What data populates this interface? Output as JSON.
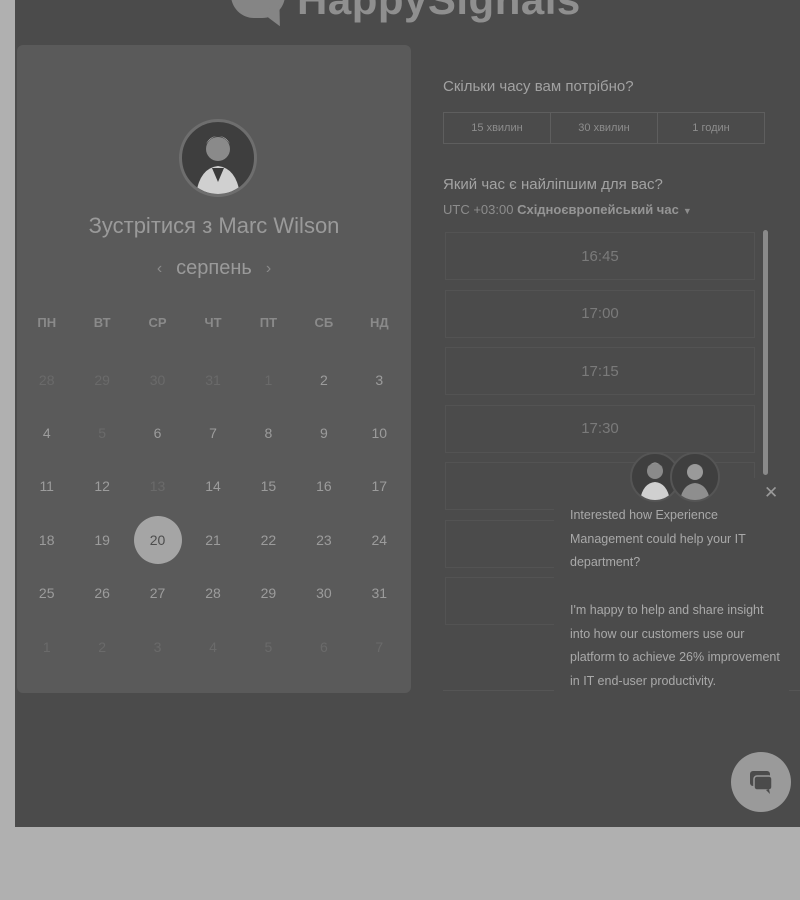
{
  "header": {
    "logo_text": "HappySignals"
  },
  "booking": {
    "meet_title": "Зустрітися з Marc Wilson",
    "month": "серпень",
    "weekdays": [
      "ПН",
      "ВТ",
      "СР",
      "ЧТ",
      "ПТ",
      "СБ",
      "НД"
    ],
    "days": [
      {
        "n": "28",
        "muted": true
      },
      {
        "n": "29",
        "muted": true
      },
      {
        "n": "30",
        "muted": true
      },
      {
        "n": "31",
        "muted": true
      },
      {
        "n": "1",
        "muted": true
      },
      {
        "n": "2"
      },
      {
        "n": "3"
      },
      {
        "n": "4"
      },
      {
        "n": "5",
        "muted": true
      },
      {
        "n": "6"
      },
      {
        "n": "7"
      },
      {
        "n": "8"
      },
      {
        "n": "9"
      },
      {
        "n": "10"
      },
      {
        "n": "11"
      },
      {
        "n": "12"
      },
      {
        "n": "13",
        "muted": true
      },
      {
        "n": "14"
      },
      {
        "n": "15"
      },
      {
        "n": "16"
      },
      {
        "n": "17"
      },
      {
        "n": "18"
      },
      {
        "n": "19"
      },
      {
        "n": "20",
        "selected": true
      },
      {
        "n": "21"
      },
      {
        "n": "22"
      },
      {
        "n": "23"
      },
      {
        "n": "24"
      },
      {
        "n": "25"
      },
      {
        "n": "26"
      },
      {
        "n": "27"
      },
      {
        "n": "28"
      },
      {
        "n": "29"
      },
      {
        "n": "30"
      },
      {
        "n": "31"
      },
      {
        "n": "1",
        "muted": true
      },
      {
        "n": "2",
        "muted": true
      },
      {
        "n": "3",
        "muted": true
      },
      {
        "n": "4",
        "muted": true
      },
      {
        "n": "5",
        "muted": true
      },
      {
        "n": "6",
        "muted": true
      },
      {
        "n": "7",
        "muted": true
      }
    ]
  },
  "duration": {
    "question": "Скільки часу вам потрібно?",
    "options": [
      "15 хвилин",
      "30 хвилин",
      "1 годин"
    ]
  },
  "time": {
    "question": "Який час є найліпшим для вас?",
    "tz_offset": "UTC +03:00",
    "tz_name": "Східноєвропейський час",
    "slots": [
      "16:45",
      "17:00",
      "17:15",
      "17:30",
      "",
      "",
      ""
    ]
  },
  "chat": {
    "message": "Interested how Experience Management could help your IT department?\n\nI'm happy to help and share insight into how our customers use our platform to achieve 26% improvement in IT end-user productivity."
  },
  "colors": {
    "overlay_bg": "#4b4b4b",
    "panel_bg": "#5a5a5a",
    "selected_day": "#a5a5a5",
    "page_bg": "#b0b0b0"
  }
}
